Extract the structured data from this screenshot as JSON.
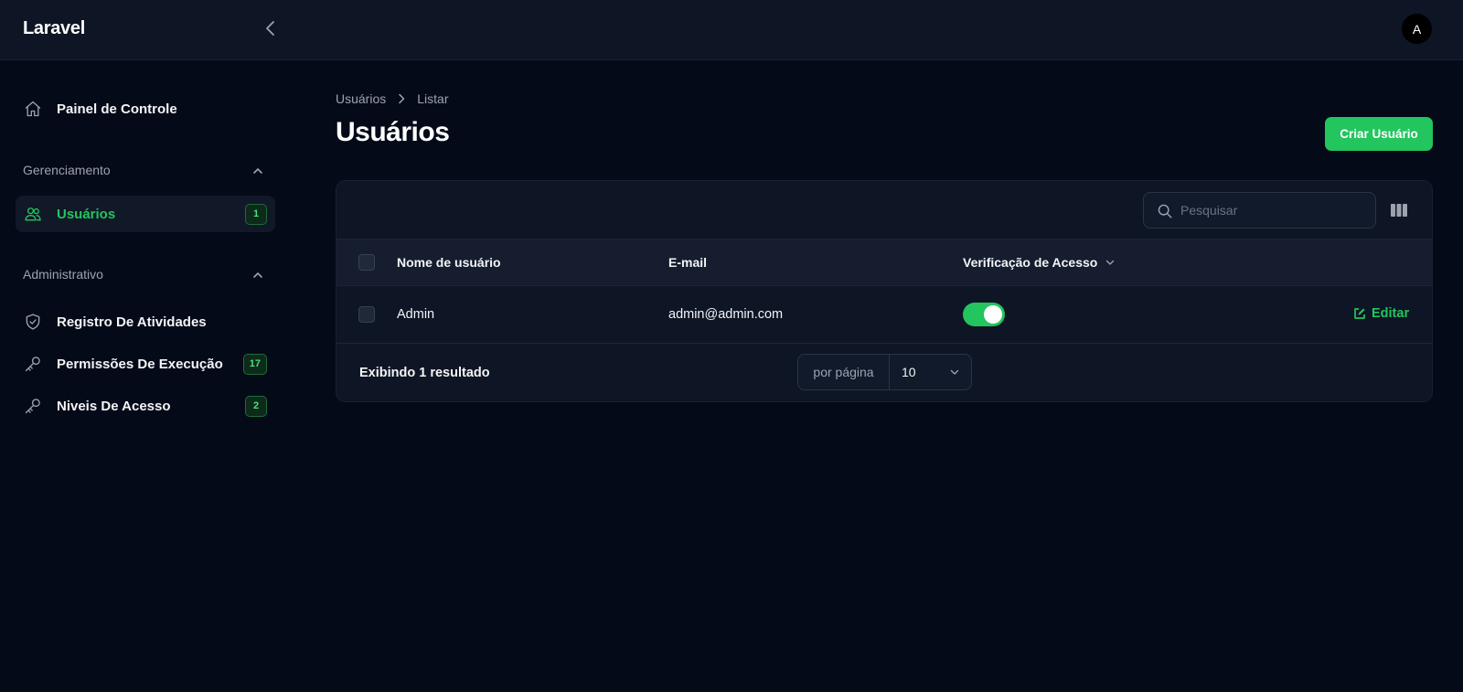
{
  "app": {
    "brand": "Laravel",
    "avatar_initial": "A"
  },
  "sidebar": {
    "dashboard": {
      "label": "Painel de Controle",
      "icon": "home-icon"
    },
    "groups": [
      {
        "title": "Gerenciamento",
        "items": [
          {
            "label": "Usuários",
            "icon": "users-icon",
            "badge": "1",
            "active": true
          }
        ]
      },
      {
        "title": "Administrativo",
        "items": [
          {
            "label": "Registro De Atividades",
            "icon": "shield-check-icon"
          },
          {
            "label": "Permissões De Execução",
            "icon": "key-icon",
            "badge": "17"
          },
          {
            "label": "Niveis De Acesso",
            "icon": "key-icon",
            "badge": "2"
          }
        ]
      }
    ]
  },
  "page": {
    "breadcrumb": [
      "Usuários",
      "Listar"
    ],
    "title": "Usuários",
    "create_button": "Criar Usuário"
  },
  "table": {
    "search_placeholder": "Pesquisar",
    "columns": [
      "Nome de usuário",
      "E-mail",
      "Verificação de Acesso"
    ],
    "rows": [
      {
        "name": "Admin",
        "email": "admin@admin.com",
        "access_verified": true,
        "action": "Editar"
      }
    ],
    "footer": {
      "summary": "Exibindo 1 resultado",
      "per_page_label": "por página",
      "per_page_value": "10"
    }
  },
  "colors": {
    "accent": "#22c55e",
    "background": "#050a18",
    "surface": "#0e1525"
  }
}
